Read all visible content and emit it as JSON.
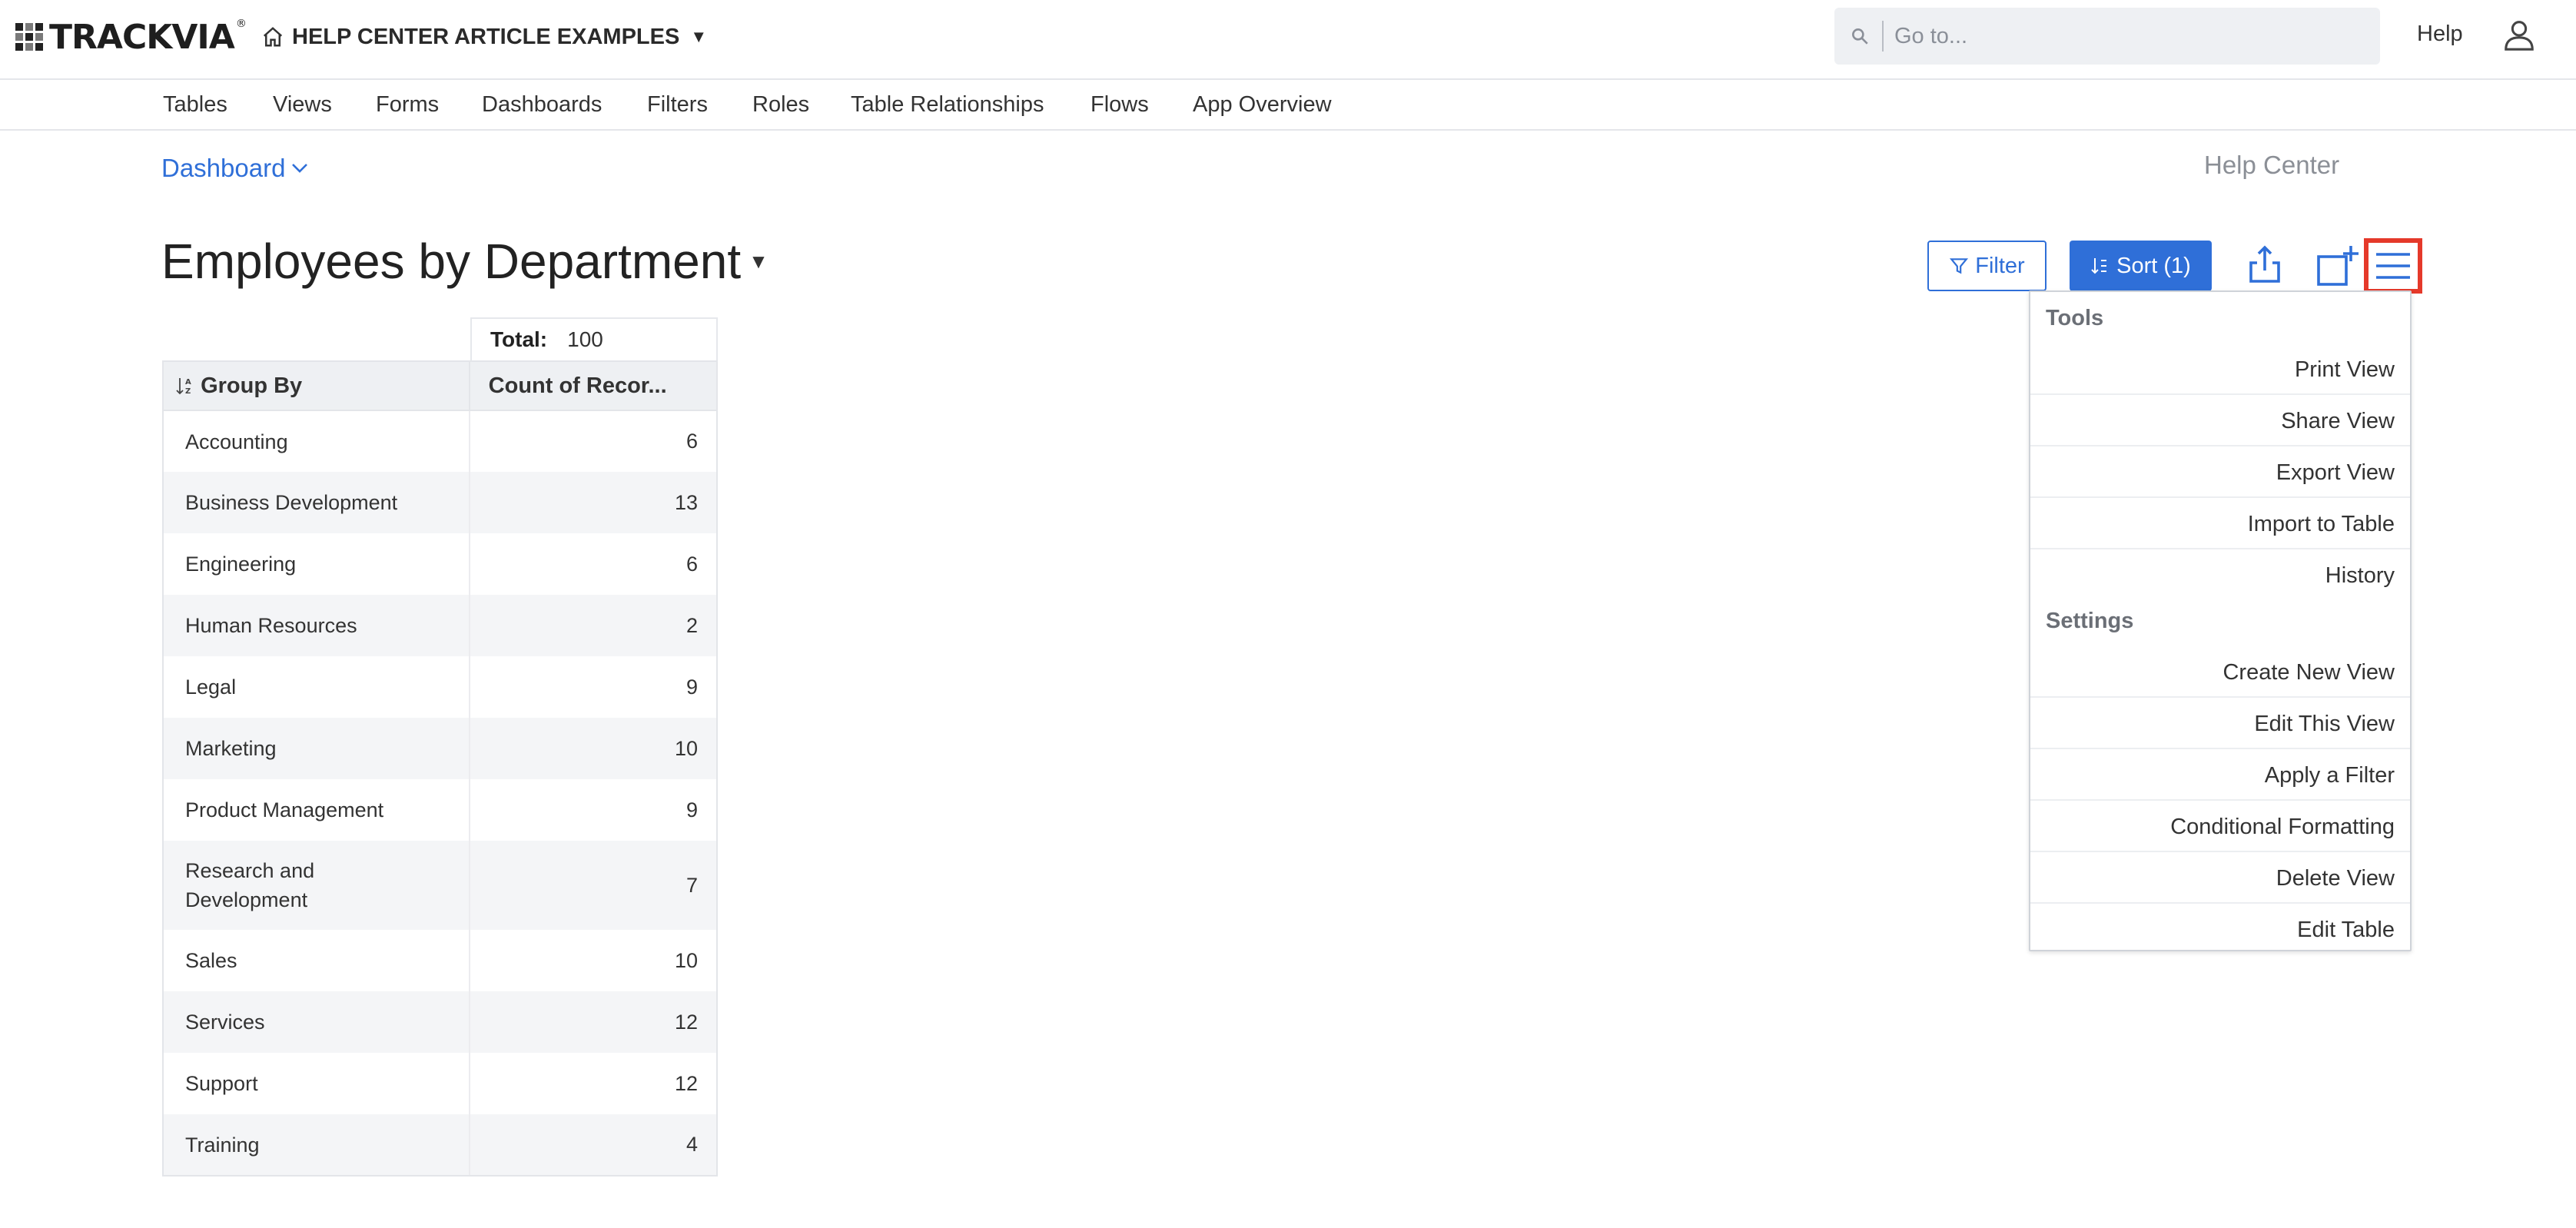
{
  "header": {
    "logo_text": "TRACKVIA",
    "logo_mark": "®",
    "app_title": "HELP CENTER ARTICLE EXAMPLES",
    "search_placeholder": "Go to...",
    "help_label": "Help"
  },
  "nav": {
    "items": [
      "Tables",
      "Views",
      "Forms",
      "Dashboards",
      "Filters",
      "Roles",
      "Table Relationships",
      "Flows",
      "App Overview"
    ]
  },
  "breadcrumb": {
    "label": "Dashboard"
  },
  "help_center_label": "Help Center",
  "page": {
    "title": "Employees by Department"
  },
  "toolbar": {
    "filter_label": "Filter",
    "sort_label": "Sort (1)"
  },
  "table": {
    "total_label": "Total:",
    "total_value": "100",
    "headers": [
      "Group By",
      "Count of Recor..."
    ],
    "rows": [
      {
        "name": "Accounting",
        "count": "6"
      },
      {
        "name": "Business Development",
        "count": "13"
      },
      {
        "name": "Engineering",
        "count": "6"
      },
      {
        "name": "Human Resources",
        "count": "2"
      },
      {
        "name": "Legal",
        "count": "9"
      },
      {
        "name": "Marketing",
        "count": "10"
      },
      {
        "name": "Product Management",
        "count": "9"
      },
      {
        "name": "Research and Development",
        "count": "7"
      },
      {
        "name": "Sales",
        "count": "10"
      },
      {
        "name": "Services",
        "count": "12"
      },
      {
        "name": "Support",
        "count": "12"
      },
      {
        "name": "Training",
        "count": "4"
      }
    ]
  },
  "menu": {
    "tools_label": "Tools",
    "tools": [
      "Print View",
      "Share View",
      "Export View",
      "Import to Table",
      "History"
    ],
    "settings_label": "Settings",
    "settings": [
      "Create New View",
      "Edit This View",
      "Apply a Filter",
      "Conditional Formatting",
      "Delete View",
      "Edit Table"
    ]
  },
  "colors": {
    "accent": "#2f6fd8",
    "highlight_box": "#e5392a"
  },
  "icons": [
    "grid-logo-icon",
    "home-icon",
    "search-icon",
    "user-icon",
    "chevron-down-icon",
    "filter-icon",
    "sort-icon",
    "share-icon",
    "add-view-icon",
    "hamburger-menu-icon"
  ]
}
